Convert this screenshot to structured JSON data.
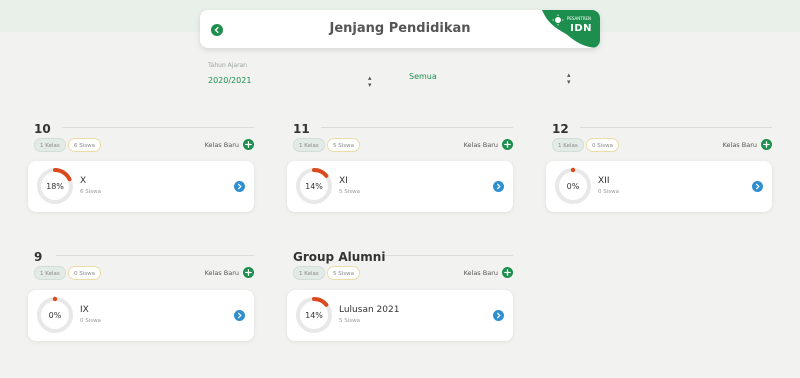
{
  "header": {
    "title": "Jenjang Pendidikan",
    "logo_text": "IDN",
    "logo_subtext": "PESANTREN"
  },
  "filters": {
    "year_label": "Tahun Ajaran",
    "year_value": "2020/2021",
    "scope_value": "Semua"
  },
  "colors": {
    "brand_green": "#1e8e4e",
    "progress_orange": "#d94a1e",
    "track_gray": "#e8e8e8",
    "action_blue": "#2f8fcf"
  },
  "add_label": "Kelas Baru",
  "sections": [
    {
      "title": "10",
      "kelas_pill": "1 Kelas",
      "siswa_pill": "6 Siswa",
      "classes": [
        {
          "percent_label": "18%",
          "percent": 18,
          "name": "X",
          "count": "6 Siswa"
        }
      ]
    },
    {
      "title": "11",
      "kelas_pill": "1 Kelas",
      "siswa_pill": "5 Siswa",
      "classes": [
        {
          "percent_label": "14%",
          "percent": 14,
          "name": "XI",
          "count": "5 Siswa"
        }
      ]
    },
    {
      "title": "12",
      "kelas_pill": "1 Kelas",
      "siswa_pill": "0 Siswa",
      "classes": [
        {
          "percent_label": "0%",
          "percent": 0,
          "name": "XII",
          "count": "0 Siswa"
        }
      ]
    },
    {
      "title": "9",
      "kelas_pill": "1 Kelas",
      "siswa_pill": "0 Siswa",
      "classes": [
        {
          "percent_label": "0%",
          "percent": 0,
          "name": "IX",
          "count": "0 Siswa"
        }
      ]
    },
    {
      "title": "Group Alumni",
      "kelas_pill": "1 Kelas",
      "siswa_pill": "5 Siswa",
      "classes": [
        {
          "percent_label": "14%",
          "percent": 14,
          "name": "Lulusan 2021",
          "count": "5 Siswa"
        }
      ]
    }
  ]
}
